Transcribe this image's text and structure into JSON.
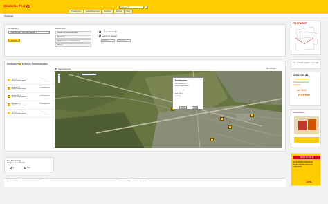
{
  "header": {
    "logo_text": "Deutsche Post",
    "search_placeholder": "Suchbegriff",
    "search_button": "»",
    "nav": [
      "Privatkunden",
      "Geschäftskunden",
      "Postfinder",
      "Service",
      "Shop"
    ]
  },
  "page": {
    "title": "Postfinder"
  },
  "finder": {
    "location_label": "Ihr Standort",
    "location_value": "Friedrichshafen, Otto-Lilienthal-Str. 1",
    "find_button": "Suchen",
    "search_for_label": "Suche nach",
    "categories": [
      "Filialen und Verkaufspunkte",
      "Briefkästen",
      "Packstationen und Paketboxen",
      "Weitere"
    ],
    "options": [
      "Leerung nach 18 Uhr",
      "Leerung am Samstag"
    ],
    "weekday_select": "Montag",
    "time_select": "17:00 Uhr"
  },
  "promo": {
    "title": "POSTBRIEF",
    "subtitle": "Hier bestellt - sicher zugestellt"
  },
  "results": {
    "title_prefix": "Briefkasten",
    "title_suffix": "in 88048 Friedrichshafen",
    "center_option": "Kartenmittelpunkt",
    "all_link": "Alle anzeigen",
    "items": [
      {
        "name": "Otto-Lilienthal-Str. 1",
        "city": "88046 Friedrichshafen",
        "link": "Leerungszeiten"
      },
      {
        "name": "Flughafen 12",
        "city": "88046 Friedrichshafen",
        "link": "Leerungszeiten"
      },
      {
        "name": "Ailinger Str. 52",
        "city": "88046 Friedrichshafen",
        "link": "Leerungszeiten"
      },
      {
        "name": "Seestraße 10",
        "city": "88045 Friedrichshafen",
        "link": "Leerungszeiten"
      },
      {
        "name": "Eckenerstraße 13",
        "city": "88046 Friedrichshafen",
        "link": "Leerungszeiten"
      }
    ]
  },
  "map": {
    "type_button": "Kartenansicht",
    "zoom_in": "+",
    "zoom_out": "−",
    "popup": {
      "title": "Briefkasten",
      "address": "Otto-Lilienthal-Str. 1",
      "city": "88046 Friedrichshafen",
      "times_label": "Leerungszeiten",
      "row1": "Mo-Fr  18:00",
      "row2": "Sa        12:00",
      "btn_zoom": "Zoomen",
      "btn_print": "Route",
      "close": "x"
    }
  },
  "sidebar_ads": {
    "amazon_title": "amazon.de",
    "amazon_line1": "Versandkostenfreie",
    "amazon_line2": "Lieferung",
    "amazon_line3": "ab 20 €",
    "amazon_line4": "Bücher",
    "gift_line": "Geschenkideen",
    "dhl_lines": [
      "JETZT AB 3,90 €",
      "AB SOFORT: PAKETE IN",
      "IHRER WUNSCHFILIALE",
      "ABHOLEN."
    ],
    "dhl_brand": "DHL"
  },
  "rating": {
    "title": "Ihre Bewertung",
    "question": "War diese Seite hilfreich?",
    "yes": "Ja",
    "no": "Nein"
  },
  "footer": {
    "left_link_1": "Deutsche Post AG",
    "left_link_2": "Impressum",
    "center_line": "Deutsche Post DHL",
    "right_link": "Datenschutz"
  },
  "colors": {
    "brand_yellow": "#ffcc00",
    "brand_red": "#cc0000"
  }
}
